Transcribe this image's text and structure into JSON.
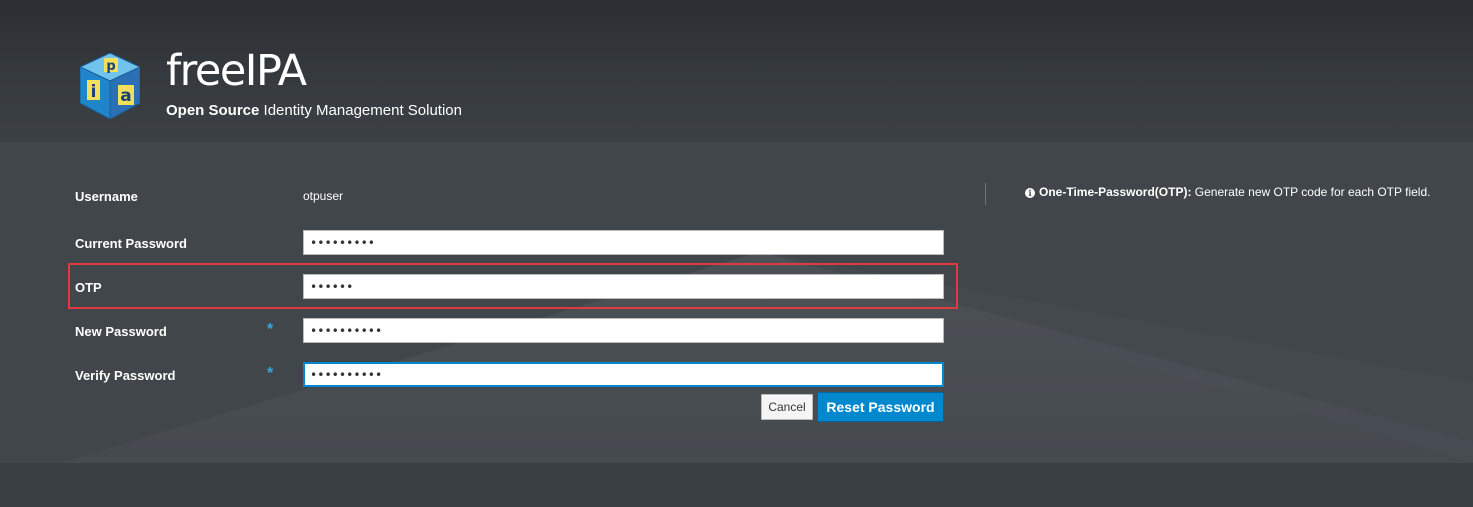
{
  "header": {
    "brand_title": "freeIPA",
    "subtitle_bold": "Open Source",
    "subtitle_rest": " Identity Management Solution",
    "logo_letters": [
      "i",
      "p",
      "a"
    ]
  },
  "form": {
    "username": {
      "label": "Username",
      "value": "otpuser"
    },
    "current_password": {
      "label": "Current Password",
      "value": "•••••••••"
    },
    "otp": {
      "label": "OTP",
      "value": "••••••"
    },
    "new_password": {
      "label": "New Password",
      "value": "••••••••••",
      "required_marker": "*"
    },
    "verify_password": {
      "label": "Verify Password",
      "value": "••••••••••",
      "required_marker": "*"
    },
    "cancel_label": "Cancel",
    "reset_label": "Reset Password"
  },
  "info": {
    "icon": "info-circle-icon",
    "title": "One-Time-Password(OTP):",
    "text": " Generate new OTP code for each OTP field."
  },
  "colors": {
    "accent": "#0088ce",
    "required": "#39a5dc",
    "highlight": "#e0393e",
    "background": "#41464b"
  }
}
